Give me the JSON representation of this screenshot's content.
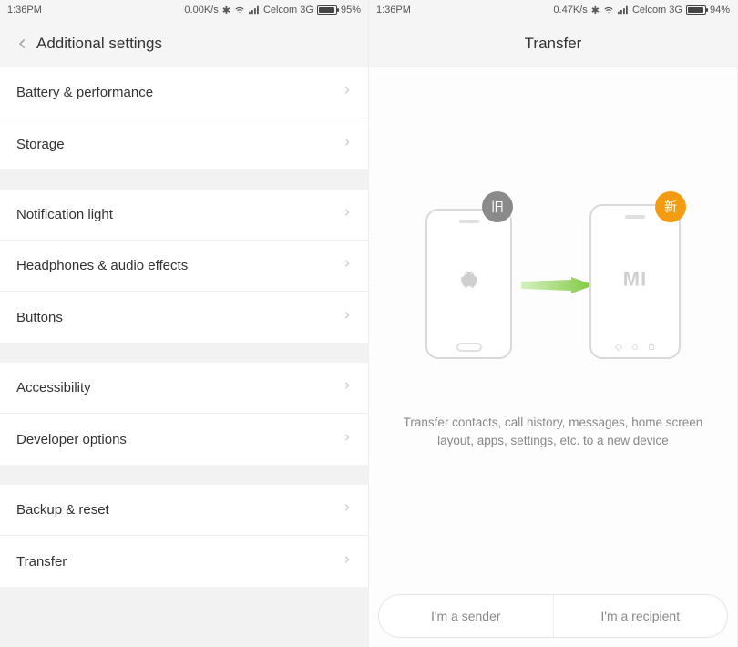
{
  "left": {
    "statusbar": {
      "time": "1:36PM",
      "speed": "0.00K/s",
      "carrier": "Celcom 3G",
      "battery_pct": "95%",
      "battery_fill": 95
    },
    "header": {
      "title": "Additional settings"
    },
    "groups": [
      {
        "rows": [
          {
            "label": "Battery & performance"
          },
          {
            "label": "Storage"
          }
        ]
      },
      {
        "rows": [
          {
            "label": "Notification light"
          },
          {
            "label": "Headphones & audio effects"
          },
          {
            "label": "Buttons"
          }
        ]
      },
      {
        "rows": [
          {
            "label": "Accessibility"
          },
          {
            "label": "Developer options"
          }
        ]
      },
      {
        "rows": [
          {
            "label": "Backup & reset"
          },
          {
            "label": "Transfer"
          }
        ]
      }
    ]
  },
  "right": {
    "statusbar": {
      "time": "1:36PM",
      "speed": "0.47K/s",
      "carrier": "Celcom 3G",
      "battery_pct": "94%",
      "battery_fill": 94
    },
    "header": {
      "title": "Transfer"
    },
    "badges": {
      "old": "旧",
      "new": "新"
    },
    "mi_logo": "MI",
    "description": "Transfer contacts, call history, messages, home screen layout, apps, settings, etc. to a new device",
    "buttons": {
      "sender": "I'm a sender",
      "recipient": "I'm a recipient"
    }
  }
}
